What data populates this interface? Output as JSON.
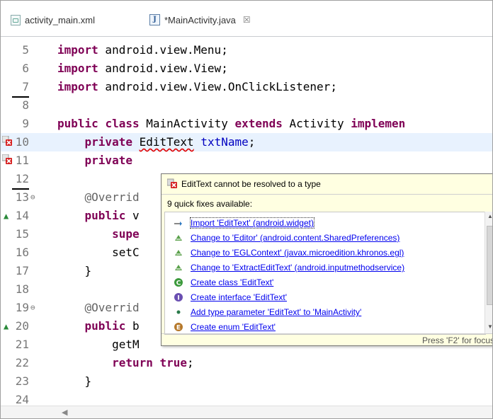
{
  "tabs": [
    {
      "label": "activity_main.xml"
    },
    {
      "label": "*MainActivity.java",
      "close": "☒"
    }
  ],
  "editor": {
    "lines": [
      {
        "num": "5",
        "tokens": [
          {
            "t": "import",
            "c": "kw"
          },
          {
            "t": " android.view.Menu;"
          }
        ]
      },
      {
        "num": "6",
        "tokens": [
          {
            "t": "import",
            "c": "kw"
          },
          {
            "t": " android.view.View;"
          }
        ]
      },
      {
        "num": "7",
        "tokens": [
          {
            "t": "import",
            "c": "kw"
          },
          {
            "t": " android.view.View.OnClickListener;"
          }
        ]
      },
      {
        "num": "8",
        "tokens": []
      },
      {
        "num": "9",
        "tokens": [
          {
            "t": "public",
            "c": "kw"
          },
          {
            "t": " "
          },
          {
            "t": "class",
            "c": "kw"
          },
          {
            "t": " MainActivity "
          },
          {
            "t": "extends",
            "c": "kw"
          },
          {
            "t": " Activity "
          },
          {
            "t": "implemen",
            "c": "kw"
          }
        ]
      },
      {
        "num": "10",
        "tokens": [
          {
            "t": "    "
          },
          {
            "t": "private",
            "c": "kw"
          },
          {
            "t": " "
          },
          {
            "t": "EditText",
            "c": "err"
          },
          {
            "t": " "
          },
          {
            "t": "txtName",
            "c": "fld"
          },
          {
            "t": ";"
          }
        ]
      },
      {
        "num": "11",
        "tokens": [
          {
            "t": "    "
          },
          {
            "t": "private",
            "c": "kw"
          },
          {
            "t": " "
          }
        ]
      },
      {
        "num": "12",
        "tokens": []
      },
      {
        "num": "13",
        "tokens": [
          {
            "t": "    "
          },
          {
            "t": "@Overrid",
            "c": "ann"
          }
        ]
      },
      {
        "num": "14",
        "tokens": [
          {
            "t": "    "
          },
          {
            "t": "public",
            "c": "kw"
          },
          {
            "t": " v"
          }
        ]
      },
      {
        "num": "15",
        "tokens": [
          {
            "t": "        "
          },
          {
            "t": "supe",
            "c": "kw"
          }
        ]
      },
      {
        "num": "16",
        "tokens": [
          {
            "t": "        setC"
          }
        ]
      },
      {
        "num": "17",
        "tokens": [
          {
            "t": "    }"
          }
        ]
      },
      {
        "num": "18",
        "tokens": []
      },
      {
        "num": "19",
        "tokens": [
          {
            "t": "    "
          },
          {
            "t": "@Overrid",
            "c": "ann"
          }
        ]
      },
      {
        "num": "20",
        "tokens": [
          {
            "t": "    "
          },
          {
            "t": "public",
            "c": "kw"
          },
          {
            "t": " b"
          }
        ]
      },
      {
        "num": "21",
        "tokens": [
          {
            "t": "        getM"
          }
        ]
      },
      {
        "num": "22",
        "tokens": [
          {
            "t": "        "
          },
          {
            "t": "return",
            "c": "kw"
          },
          {
            "t": " "
          },
          {
            "t": "true",
            "c": "kw"
          },
          {
            "t": ";"
          }
        ]
      },
      {
        "num": "23",
        "tokens": [
          {
            "t": "    }"
          }
        ]
      },
      {
        "num": "24",
        "tokens": []
      }
    ]
  },
  "quickfix": {
    "error_message": "EditText cannot be resolved to a type",
    "count_label": "9 quick fixes available:",
    "items": [
      {
        "label": "Import 'EditText' (android.widget)",
        "icon": "import-icon"
      },
      {
        "label": "Change to 'Editor' (android.content.SharedPreferences)",
        "icon": "change-icon"
      },
      {
        "label": "Change to 'EGLContext' (javax.microedition.khronos.egl)",
        "icon": "change-icon"
      },
      {
        "label": "Change to 'ExtractEditText' (android.inputmethodservice)",
        "icon": "change-icon"
      },
      {
        "label": "Create class 'EditText'",
        "icon": "class-icon"
      },
      {
        "label": "Create interface 'EditText'",
        "icon": "interface-icon"
      },
      {
        "label": "Add type parameter 'EditText' to 'MainActivity'",
        "icon": "type-param-icon"
      },
      {
        "label": "Create enum 'EditText'",
        "icon": "enum-icon"
      }
    ],
    "footer": "Press 'F2' for focus"
  },
  "colors": {
    "keyword": "#7f0055",
    "field": "#0000c0",
    "annotation": "#646464",
    "popup_bg": "#ffffe1",
    "current_line": "#e8f2fe"
  }
}
